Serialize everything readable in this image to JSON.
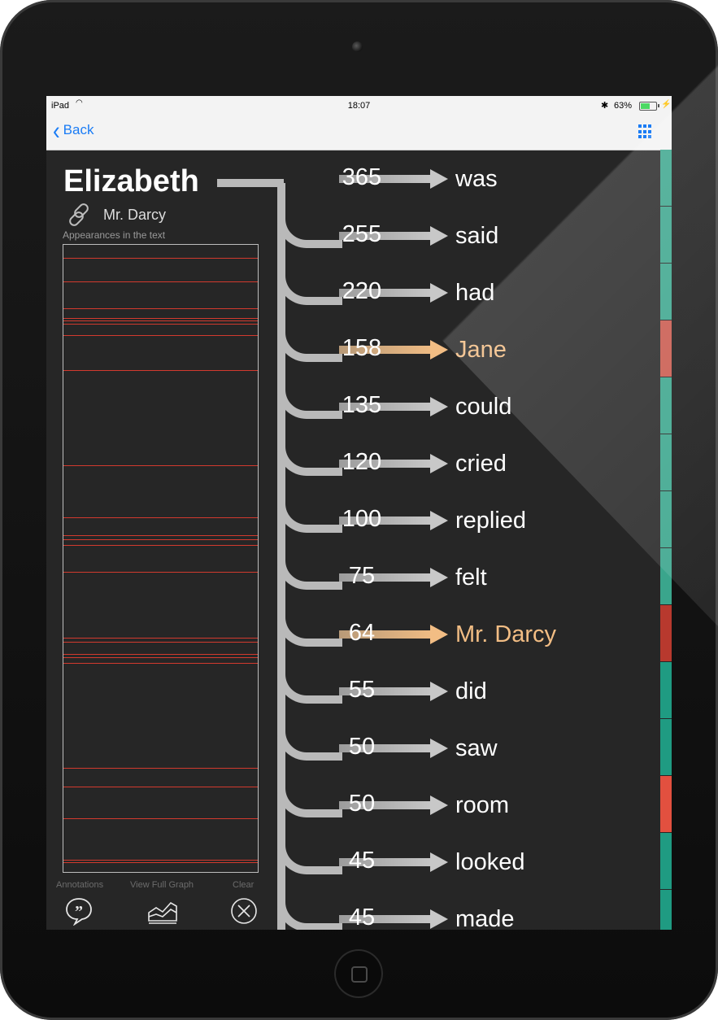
{
  "status_bar": {
    "carrier": "iPad",
    "time": "18:07",
    "battery_percent": "63%",
    "battery_level": 0.63
  },
  "nav": {
    "back_label": "Back"
  },
  "character": {
    "name": "Elizabeth",
    "linked_name": "Mr. Darcy"
  },
  "appearances": {
    "label": "Appearances in the text",
    "line_positions_fraction": [
      0.021,
      0.058,
      0.101,
      0.117,
      0.12,
      0.126,
      0.144,
      0.2,
      0.352,
      0.434,
      0.463,
      0.47,
      0.478,
      0.521,
      0.627,
      0.633,
      0.652,
      0.657,
      0.667,
      0.834,
      0.864,
      0.915,
      0.981,
      0.985
    ]
  },
  "toolbar": {
    "annotations_label": "Annotations",
    "view_full_graph_label": "View Full Graph",
    "clear_label": "Clear"
  },
  "colors": {
    "highlight": "#f2bd84",
    "appearance_line": "#d23a2e",
    "accent": "#1a7cf5"
  },
  "words": [
    {
      "count": "365",
      "word": "was",
      "highlight": false,
      "tag_color": "#3aa58c"
    },
    {
      "count": "255",
      "word": "said",
      "highlight": false,
      "tag_color": "#3aa58c"
    },
    {
      "count": "220",
      "word": "had",
      "highlight": false,
      "tag_color": "#3aa58c"
    },
    {
      "count": "158",
      "word": "Jane",
      "highlight": true,
      "tag_color": "#c9584c"
    },
    {
      "count": "135",
      "word": "could",
      "highlight": false,
      "tag_color": "#3aa58c"
    },
    {
      "count": "120",
      "word": "cried",
      "highlight": false,
      "tag_color": "#3aa58c"
    },
    {
      "count": "100",
      "word": "replied",
      "highlight": false,
      "tag_color": "#3aa58c"
    },
    {
      "count": "75",
      "word": "felt",
      "highlight": false,
      "tag_color": "#3aa58c"
    },
    {
      "count": "64",
      "word": "Mr. Darcy",
      "highlight": true,
      "tag_color": "#b8392e"
    },
    {
      "count": "55",
      "word": "did",
      "highlight": false,
      "tag_color": "#1f9b82"
    },
    {
      "count": "50",
      "word": "saw",
      "highlight": false,
      "tag_color": "#1f9b82"
    },
    {
      "count": "50",
      "word": "room",
      "highlight": false,
      "tag_color": "#e2503f"
    },
    {
      "count": "45",
      "word": "looked",
      "highlight": false,
      "tag_color": "#1f9b82"
    },
    {
      "count": "45",
      "word": "made",
      "highlight": false,
      "tag_color": "#1f9b82"
    }
  ]
}
